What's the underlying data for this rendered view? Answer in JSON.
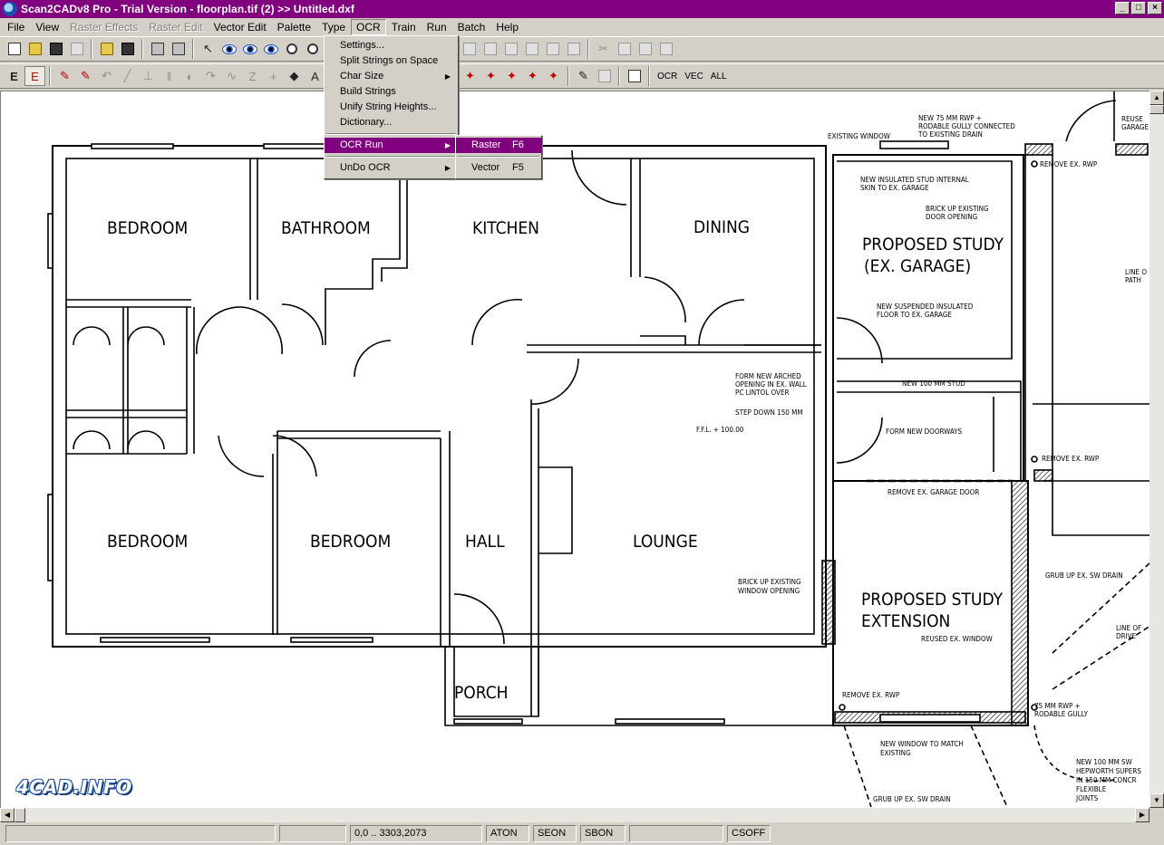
{
  "window": {
    "title": "Scan2CADv8 Pro - Trial Version  -  floorplan.tif (2) >> Untitled.dxf",
    "buttons": [
      "_",
      "□",
      "×"
    ]
  },
  "menubar": [
    {
      "label": "File",
      "enabled": true
    },
    {
      "label": "View",
      "enabled": true
    },
    {
      "label": "Raster Effects",
      "enabled": false
    },
    {
      "label": "Raster Edit",
      "enabled": false
    },
    {
      "label": "Vector Edit",
      "enabled": true
    },
    {
      "label": "Palette",
      "enabled": true
    },
    {
      "label": "Type",
      "enabled": true
    },
    {
      "label": "OCR",
      "enabled": true,
      "open": true
    },
    {
      "label": "Train",
      "enabled": true
    },
    {
      "label": "Run",
      "enabled": true
    },
    {
      "label": "Batch",
      "enabled": true
    },
    {
      "label": "Help",
      "enabled": true
    }
  ],
  "toolbar2_text": [
    "OCR",
    "VEC",
    "ALL"
  ],
  "ocr_menu": {
    "items": [
      {
        "label": "Settings..."
      },
      {
        "label": "Split Strings on Space"
      },
      {
        "label": "Char Size",
        "submenu": true
      },
      {
        "label": "Build Strings"
      },
      {
        "label": "Unify String Heights..."
      },
      {
        "label": "Dictionary..."
      }
    ],
    "run": {
      "label": "OCR Run",
      "submenu": true,
      "selected": true
    },
    "undo": {
      "label": "UnDo OCR",
      "submenu": true
    }
  },
  "ocr_run_submenu": [
    {
      "label": "Raster",
      "shortcut": "F6",
      "selected": true
    },
    {
      "label": "Vector",
      "shortcut": "F5"
    }
  ],
  "drawing": {
    "rooms": {
      "bedroom1": "BEDROOM",
      "bathroom": "BATHROOM",
      "kitchen": "KITCHEN",
      "dining": "DINING",
      "study1_line1": "PROPOSED STUDY",
      "study1_line2": "(EX. GARAGE)",
      "bedroom2": "BEDROOM",
      "bedroom3": "BEDROOM",
      "hall": "HALL",
      "lounge": "LOUNGE",
      "study2_line1": "PROPOSED STUDY",
      "study2_line2": "EXTENSION",
      "porch": "PORCH"
    },
    "notes": {
      "existing_window": "EXISTING WINDOW",
      "rwp1": "NEW 75 MM RWP +",
      "rwp2": "RODABLE GULLY CONNECTED",
      "rwp3": "TO EXISTING DRAIN",
      "reuse1": "REUSE",
      "reuse2": "GARAGE",
      "remove_rwp_top": "REMOVE EX. RWP",
      "insulated1": "NEW INSULATED STUD INTERNAL",
      "insulated2": "SKIN TO EX. GARAGE",
      "brick1": "BRICK UP EXISTING",
      "brick2": "DOOR OPENING",
      "line1": "LINE O",
      "line2": "PATH",
      "suspended1": "NEW SUSPENDED INSULATED",
      "suspended2": "FLOOR TO EX. GARAGE",
      "arched1": "FORM NEW ARCHED",
      "arched2": "OPENING IN EX. WALL",
      "arched3": "PC LINTOL OVER",
      "stud": "NEW 100 MM STUD",
      "step": "STEP DOWN 150 MM",
      "ffl": "F.F.L. + 100.00",
      "doorways": "FORM NEW DOORWAYS",
      "remove_rwp_mid": "REMOVE EX. RWP",
      "garage_door": "REMOVE EX. GARAGE DOOR",
      "grub_top": "GRUB UP EX. SW DRAIN",
      "brick_window1": "BRICK UP EXISTING",
      "brick_window2": "WINDOW OPENING",
      "reused_window": "REUSED EX. WINDOW",
      "line_drive1": "LINE OF",
      "line_drive2": "DRIVE",
      "remove_rwp_bottom": "REMOVE EX. RWP",
      "rwp75_1": "75 MM RWP +",
      "rwp75_2": "RODABLE GULLY",
      "new_window1": "NEW WINDOW TO MATCH",
      "new_window2": "EXISTING",
      "pipe1": "NEW 100 MM SW",
      "pipe2": "HEPWORTH SUPERS",
      "pipe3": "IN 150 MM CONCR",
      "pipe4": "FLEXIBLE",
      "pipe5": "JOINTS",
      "grub_bottom": "GRUB UP EX. SW DRAIN"
    }
  },
  "watermark": "4CAD.INFO",
  "statusbar": [
    "",
    "",
    "0,0 .. 3303,2073",
    "ATON",
    "SEON",
    "SBON",
    "",
    "CSOFF"
  ]
}
